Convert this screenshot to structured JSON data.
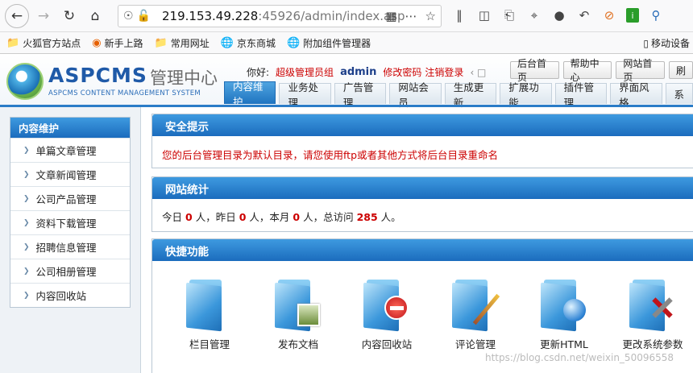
{
  "browser": {
    "url_host": "219.153.49.228",
    "url_rest": ":45926/admin/index.asp"
  },
  "bookmarks": [
    {
      "label": "火狐官方站点",
      "icon": "folder-icon"
    },
    {
      "label": "新手上路",
      "icon": "firefox-icon"
    },
    {
      "label": "常用网址",
      "icon": "folder-icon"
    },
    {
      "label": "京东商城",
      "icon": "globe-icon"
    },
    {
      "label": "附加组件管理器",
      "icon": "globe-icon"
    }
  ],
  "bookmarks_right": "移动设备",
  "header": {
    "logo_text": "ASPCMS",
    "logo_cn": "管理中心",
    "logo_sub": "ASPCMS CONTENT MANAGEMENT SYSTEM",
    "greeting": "你好:",
    "role": "超级管理员组",
    "user": "admin",
    "change_pwd": "修改密码",
    "logout": "注销登录",
    "top_buttons": [
      "后台首页",
      "帮助中心",
      "网站首页",
      "刷"
    ],
    "tabs": [
      "内容维护",
      "业务处理",
      "广告管理",
      "网站会员",
      "生成更新",
      "扩展功能",
      "插件管理",
      "界面风格",
      "系"
    ]
  },
  "sidebar": {
    "title": "内容维护",
    "items": [
      "单篇文章管理",
      "文章新闻管理",
      "公司产品管理",
      "资料下载管理",
      "招聘信息管理",
      "公司相册管理",
      "内容回收站"
    ]
  },
  "security": {
    "title": "安全提示",
    "message": "您的后台管理目录为默认目录，请您使用ftp或者其他方式将后台目录重命名"
  },
  "stats": {
    "title": "网站统计",
    "today_label": "今日",
    "today": "0",
    "yesterday_label": "人，昨日",
    "yesterday": "0",
    "month_label": "人，本月",
    "month": "0",
    "total_label": "人，总访问",
    "total": "285",
    "end_label": "人。"
  },
  "quick": {
    "title": "快捷功能",
    "items": [
      "栏目管理",
      "发布文档",
      "内容回收站",
      "评论管理",
      "更新HTML",
      "更改系统参数"
    ]
  },
  "watermark": "https://blog.csdn.net/weixin_50096558"
}
